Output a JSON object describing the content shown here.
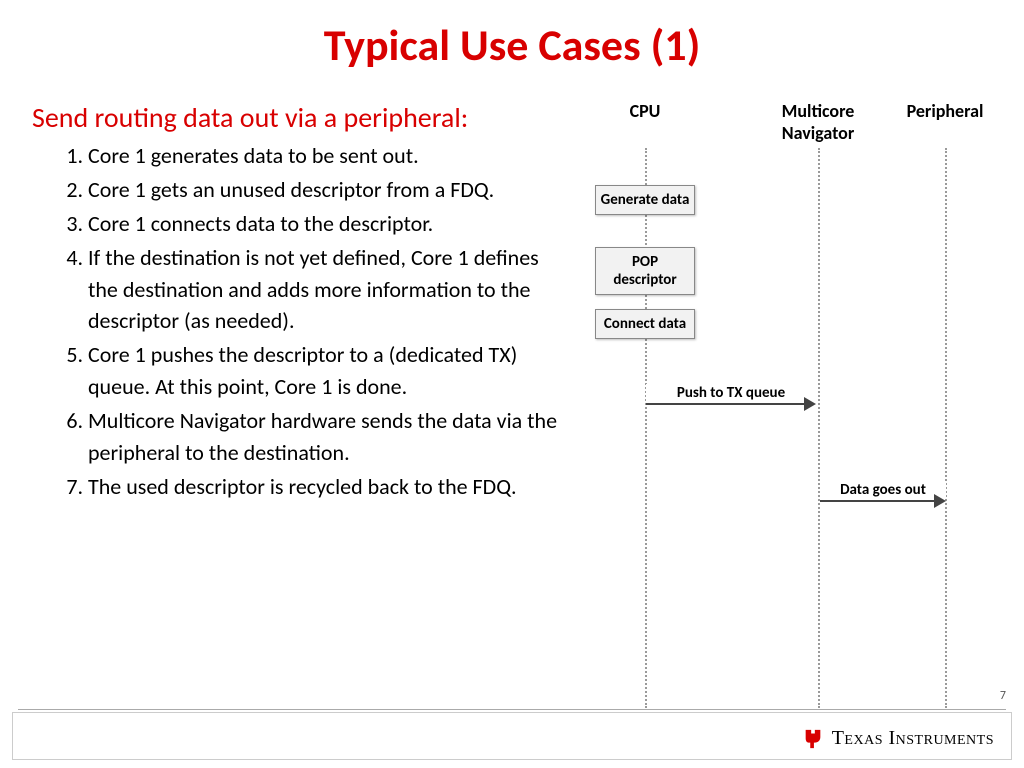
{
  "title": "Typical Use Cases (1)",
  "subtitle": "Send routing data out via a peripheral:",
  "steps": [
    "Core 1 generates data to be sent out.",
    "Core 1 gets an unused descriptor from a FDQ.",
    "Core 1 connects data to the descriptor.",
    "If the destination is not yet defined, Core 1 defines the destination and adds more information to the descriptor (as needed).",
    "Core 1 pushes the descriptor to a (dedicated TX) queue. At this point, Core 1 is done.",
    "Multicore Navigator hardware sends the data via the peripheral to the destination.",
    "The used descriptor is recycled back to the FDQ."
  ],
  "seq_headers": {
    "cpu": "CPU",
    "mn": "Multicore Navigator",
    "per": "Peripheral"
  },
  "boxes": {
    "b1": "Generate data",
    "b2": "POP descriptor",
    "b3": "Connect data"
  },
  "arrows": {
    "a1": "Push to TX queue",
    "a2": "Data goes out"
  },
  "page_number": "7",
  "logo_text": "Texas Instruments"
}
